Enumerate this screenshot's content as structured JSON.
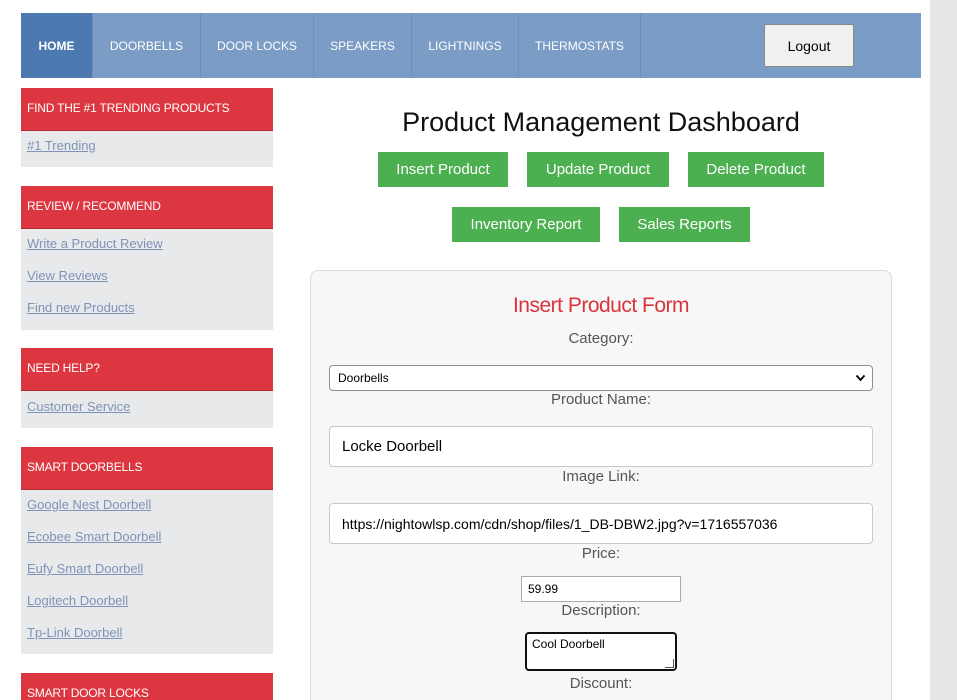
{
  "nav": {
    "items": [
      "HOME",
      "DOORBELLS",
      "DOOR LOCKS",
      "SPEAKERS",
      "LIGHTNINGS",
      "THERMOSTATS"
    ],
    "logout_label": "Logout"
  },
  "sidebar": [
    {
      "header": "FIND THE #1 TRENDING PRODUCTS",
      "links": [
        "#1 Trending"
      ]
    },
    {
      "header": "REVIEW / RECOMMEND",
      "links": [
        "Write a Product Review",
        "View Reviews",
        "Find new Products"
      ]
    },
    {
      "header": "NEED HELP?",
      "links": [
        "Customer Service"
      ]
    },
    {
      "header": "SMART DOORBELLS",
      "links": [
        "Google Nest Doorbell",
        "Ecobee Smart Doorbell",
        "Eufy Smart Doorbell",
        "Logitech Doorbell",
        "Tp-Link Doorbell"
      ]
    },
    {
      "header": "SMART DOOR LOCKS",
      "links": []
    }
  ],
  "main": {
    "title": "Product Management Dashboard",
    "buttons": [
      "Insert Product",
      "Update Product",
      "Delete Product",
      "Inventory Report",
      "Sales Reports"
    ]
  },
  "form": {
    "title": "Insert Product Form",
    "category_label": "Category:",
    "category_value": "Doorbells",
    "name_label": "Product Name:",
    "name_value": "Locke Doorbell",
    "image_label": "Image Link:",
    "image_value": "https://nightowlsp.com/cdn/shop/files/1_DB-DBW2.jpg?v=1716557036",
    "price_label": "Price:",
    "price_value": "59.99",
    "description_label": "Description:",
    "description_value": "Cool Doorbell",
    "discount_label": "Discount:"
  },
  "colors": {
    "nav_bg": "#7b9cc4",
    "nav_active": "#4c79b0",
    "sidebar_header": "#dc3640",
    "button_green": "#4caf50",
    "form_title": "#d9343d"
  }
}
